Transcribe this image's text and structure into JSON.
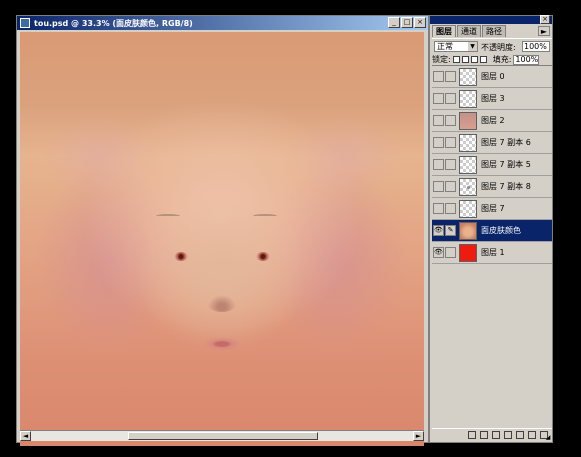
{
  "document": {
    "title": "tou.psd @ 33.3% (面皮肤颜色, RGB/8)",
    "minimize_glyph": "_",
    "maximize_glyph": "□",
    "close_glyph": "×"
  },
  "scrollbar": {
    "left_arrow": "◄",
    "right_arrow": "►"
  },
  "panel": {
    "close_glyph": "×",
    "tabs": [
      {
        "label": "图层",
        "active": true
      },
      {
        "label": "通道",
        "active": false
      },
      {
        "label": "路径",
        "active": false
      }
    ],
    "menu_glyph": "►",
    "blend_mode": "正常",
    "blend_arrow": "▼",
    "opacity_label": "不透明度:",
    "opacity_value": "100%",
    "lock_label": "锁定:",
    "fill_label": "填充:",
    "fill_value": "100%",
    "resize_glyph": "◢",
    "layers": [
      {
        "name": "图层 0",
        "visible": false,
        "thumb": "transparent",
        "selected": false
      },
      {
        "name": "图层 3",
        "visible": false,
        "thumb": "transparent",
        "selected": false
      },
      {
        "name": "图层 2",
        "visible": false,
        "thumb": "skin",
        "selected": false
      },
      {
        "name": "图层 7 副本 6",
        "visible": false,
        "thumb": "transparent",
        "selected": false
      },
      {
        "name": "图层 7 副本 5",
        "visible": false,
        "thumb": "transparent",
        "selected": false
      },
      {
        "name": "图层 7 副本 8",
        "visible": false,
        "thumb": "transparent-dot",
        "selected": false
      },
      {
        "name": "图层 7",
        "visible": false,
        "thumb": "transparent",
        "selected": false
      },
      {
        "name": "面皮肤颜色",
        "visible": true,
        "thumb": "face",
        "selected": true,
        "brush_glyph": "✎"
      },
      {
        "name": "图层 1",
        "visible": true,
        "thumb": "red",
        "selected": false
      }
    ],
    "eye_glyph": "👁"
  }
}
